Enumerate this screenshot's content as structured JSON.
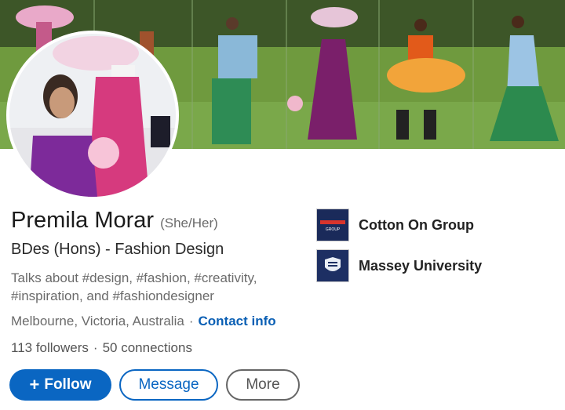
{
  "profile": {
    "name": "Premila Morar",
    "pronouns": "(She/Her)",
    "headline": "BDes (Hons) - Fashion Design",
    "talks_about": "Talks about #design, #fashion, #creativity, #inspiration, and #fashiondesigner",
    "location": "Melbourne, Victoria, Australia",
    "separator": "·",
    "contact_info": "Contact info",
    "followers": "113 followers",
    "stats_separator": "·",
    "connections": "50 connections"
  },
  "actions": {
    "follow": "Follow",
    "message": "Message",
    "more": "More"
  },
  "organizations": [
    {
      "name": "Cotton On Group",
      "logo_text": "GROUP",
      "logo_color": "#1a2a5a"
    },
    {
      "name": "Massey University",
      "logo_color": "#1d2f63"
    }
  ],
  "colors": {
    "primary": "#0a66c2",
    "link": "#0a5fb4"
  }
}
